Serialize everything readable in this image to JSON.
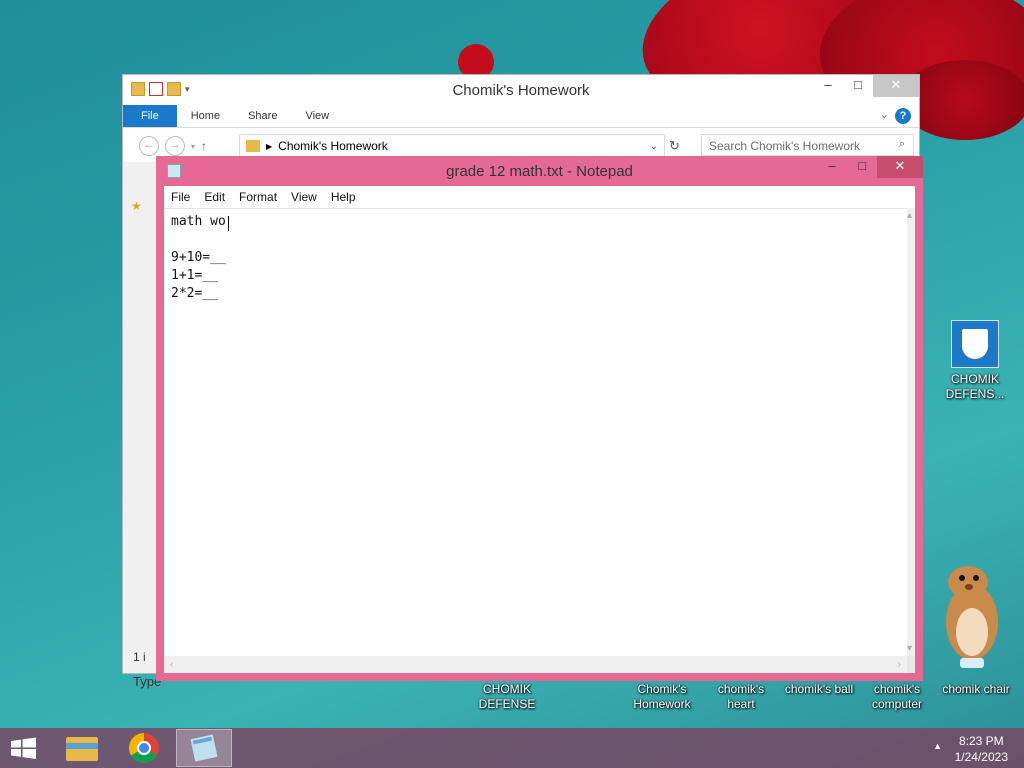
{
  "colors": {
    "notepad_frame": "#e46a95",
    "explorer_accent": "#1979ca",
    "taskbar": "#7a4664"
  },
  "explorer": {
    "title": "Chomik's Homework",
    "ribbon_tabs": [
      "File",
      "Home",
      "Share",
      "View"
    ],
    "address": "Chomik's Homework",
    "search_placeholder": "Search Chomik's Homework",
    "status_left": "1 i",
    "type_label": "Type"
  },
  "notepad": {
    "title": "grade 12 math.txt - Notepad",
    "menu": [
      "File",
      "Edit",
      "Format",
      "View",
      "Help"
    ],
    "content": "math wo\n\n9+10=__\n1+1=__\n2*2=__"
  },
  "desktop_icons": [
    {
      "label": "CHOMIK DEFENS...",
      "icon": "shield-icon"
    },
    {
      "label": "CHOMIK DEFENSE",
      "icon": "text-icon"
    },
    {
      "label": "Chomik's Homework",
      "icon": "folder-icon"
    },
    {
      "label": "chomik's heart",
      "icon": "image-icon"
    },
    {
      "label": "chomik's ball",
      "icon": "image-icon"
    },
    {
      "label": "chomik's computer",
      "icon": "image-icon"
    },
    {
      "label": "chomik chair",
      "icon": "hamster-icon"
    }
  ],
  "taskbar": {
    "items": [
      "start-icon",
      "file-explorer-icon",
      "chrome-icon",
      "notepad-icon"
    ],
    "time": "8:23 PM",
    "date": "1/24/2023"
  }
}
